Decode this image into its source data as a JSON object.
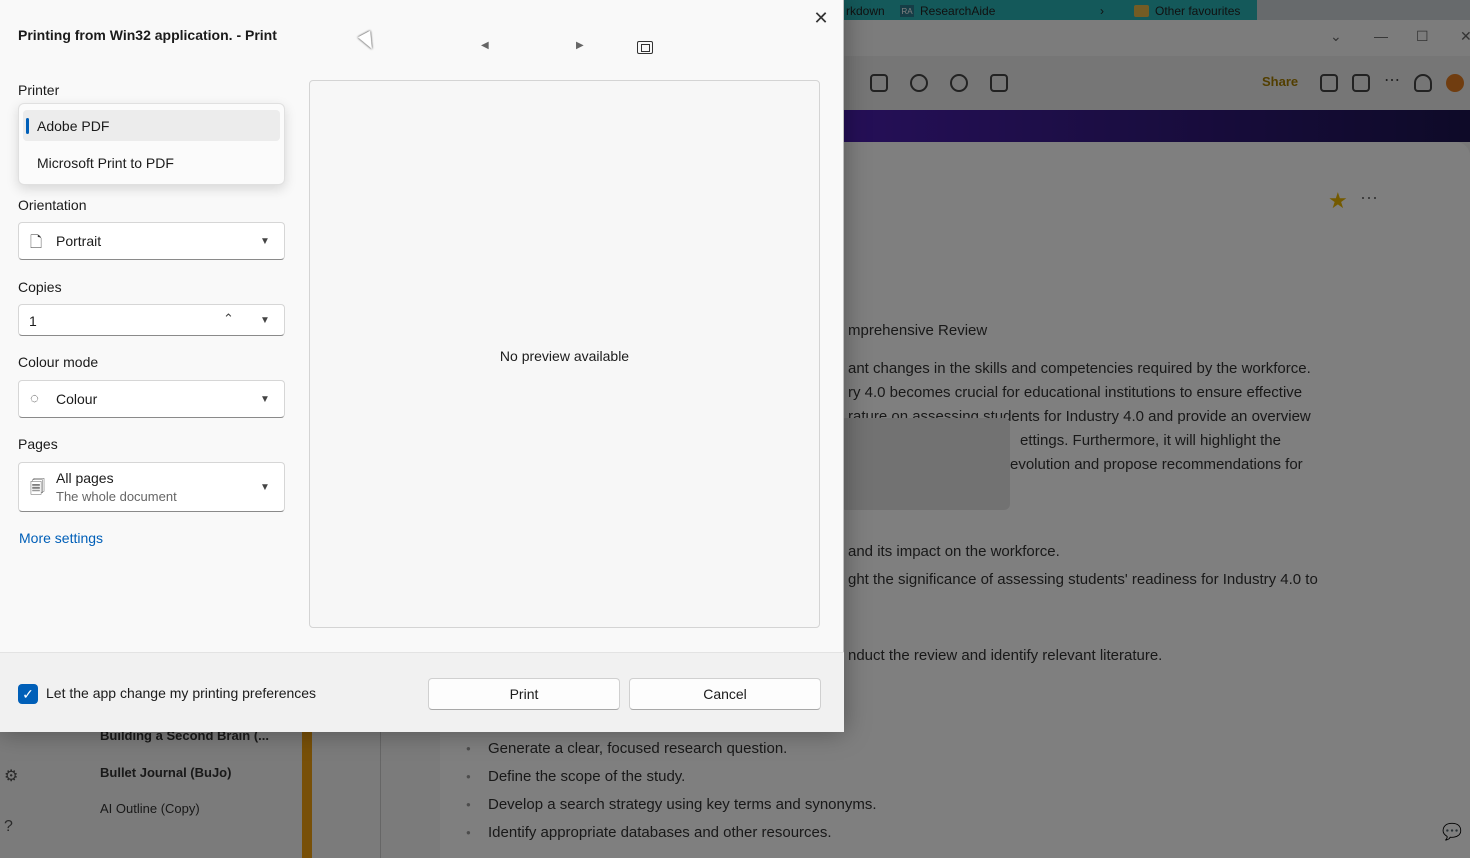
{
  "background": {
    "bookmarks": [
      "rkdown",
      "ResearchAide",
      "Other favourites"
    ],
    "share_label": "Share",
    "doc_lines": [
      "mprehensive Review",
      "ant changes in the skills and competencies required by the workforce.",
      "ry 4.0 becomes crucial for educational institutions to ensure effective",
      "rature on assessing students for Industry 4.0 and provide an overview",
      "ettings. Furthermore, it will highlight the",
      "evolution and propose recommendations for",
      "and its impact on the workforce.",
      "ght the significance of assessing students' readiness for Industry 4.0 to",
      "nduct the review and identify relevant literature."
    ],
    "bullets": [
      "Generate a clear, focused research question.",
      "Define the scope of the study.",
      "Develop a search strategy using key terms and synonyms.",
      "Identify appropriate databases and other resources."
    ],
    "sidebar_items": [
      "Building a Second Brain (...",
      "Bullet Journal (BuJo)",
      "AI Outline (Copy)"
    ]
  },
  "dialog": {
    "title": "Printing from Win32 application. - Print",
    "printer": {
      "label": "Printer",
      "options": [
        "Adobe PDF",
        "Microsoft Print to PDF"
      ],
      "selected": "Adobe PDF"
    },
    "orientation": {
      "label": "Orientation",
      "value": "Portrait"
    },
    "copies": {
      "label": "Copies",
      "value": "1"
    },
    "colour_mode": {
      "label": "Colour mode",
      "value": "Colour"
    },
    "pages": {
      "label": "Pages",
      "value": "All pages",
      "sub": "The whole document"
    },
    "more_settings": "More settings",
    "preview_message": "No preview available",
    "preferences_checkbox": {
      "label": "Let the app change my printing preferences",
      "checked": true
    },
    "buttons": {
      "print": "Print",
      "cancel": "Cancel"
    },
    "accent_color": "#005fb8"
  }
}
